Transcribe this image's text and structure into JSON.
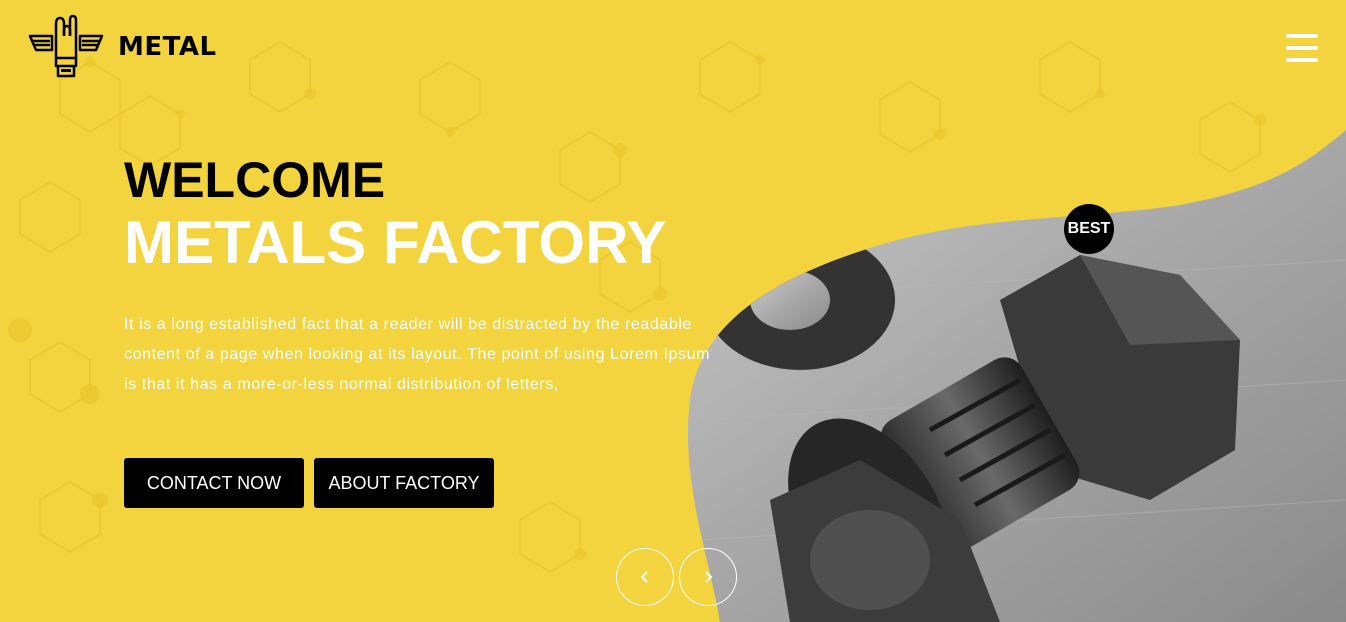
{
  "brand": {
    "name": "METAL",
    "logo_icon": "rock-hand-wings-icon"
  },
  "header": {
    "menu_icon": "hamburger-menu-icon"
  },
  "hero": {
    "welcome": "WELCOME",
    "title": "METALS FACTORY",
    "description": "It is a long established fact that a reader will be distracted by the readable content of a page when looking at its layout. The point of using Lorem Ipsum is that it has a more-or-less normal distribution of letters,",
    "buttons": {
      "contact": "CONTACT NOW",
      "about": "ABOUT FACTORY"
    },
    "badge": "BEST"
  },
  "carousel": {
    "prev_icon": "chevron-left-icon",
    "next_icon": "chevron-right-icon"
  },
  "colors": {
    "accent": "#f4d43e",
    "dark": "#000000",
    "light": "#ffffff"
  }
}
